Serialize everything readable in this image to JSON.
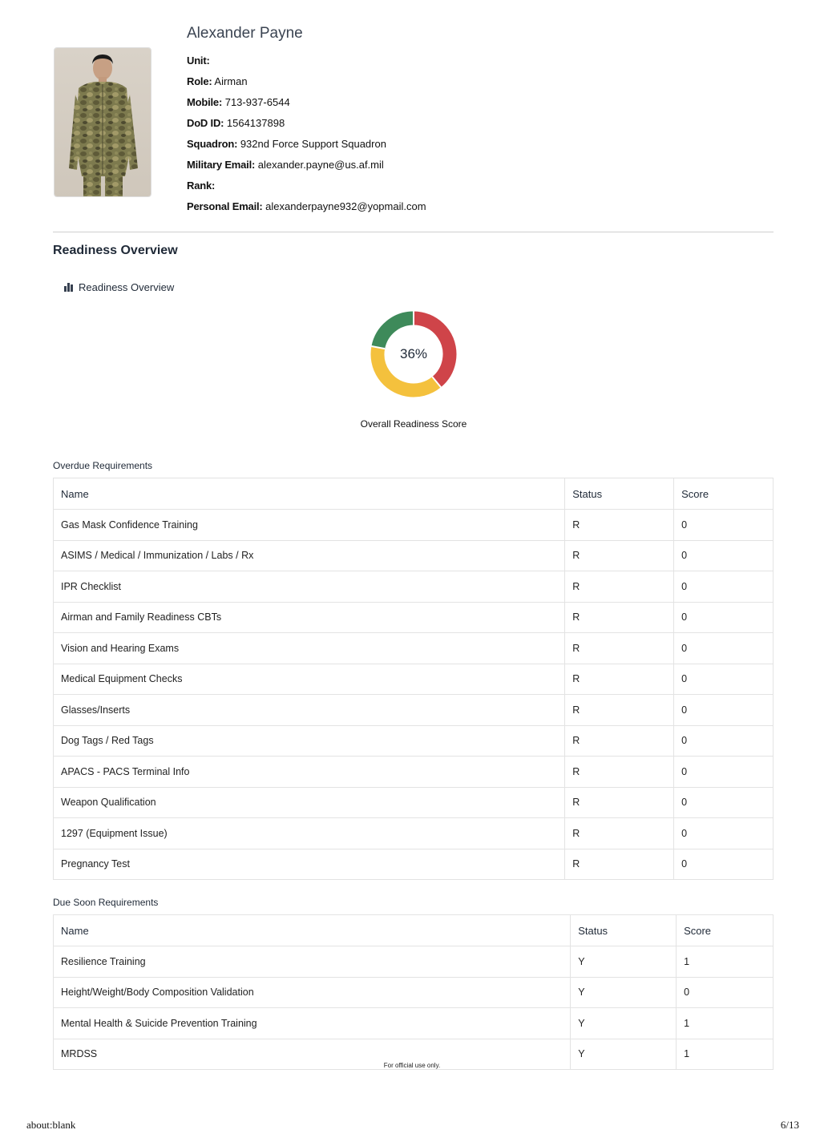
{
  "profile": {
    "name": "Alexander Payne",
    "fields": [
      {
        "label": "Unit:",
        "value": ""
      },
      {
        "label": "Role:",
        "value": "Airman"
      },
      {
        "label": "Mobile:",
        "value": "713-937-6544"
      },
      {
        "label": "DoD ID:",
        "value": "1564137898"
      },
      {
        "label": "Squadron:",
        "value": "932nd Force Support Squadron"
      },
      {
        "label": "Military Email:",
        "value": "alexander.payne@us.af.mil"
      },
      {
        "label": "Rank:",
        "value": ""
      },
      {
        "label": "Personal Email:",
        "value": "alexanderpayne932@yopmail.com"
      }
    ]
  },
  "readiness": {
    "section_title": "Readiness Overview",
    "subheading": "Readiness Overview",
    "score_label": "36%",
    "score_percent": 36,
    "caption": "Overall Readiness Score",
    "segments": [
      {
        "status": "G",
        "fraction": 0.22,
        "color": "#3e8a5a"
      },
      {
        "status": "R",
        "fraction": 0.39,
        "color": "#cf4449"
      },
      {
        "status": "Y",
        "fraction": 0.39,
        "color": "#f4c13d"
      }
    ]
  },
  "overdue": {
    "label": "Overdue Requirements",
    "headers": [
      "Name",
      "Status",
      "Score"
    ],
    "rows": [
      [
        "Gas Mask Confidence Training",
        "R",
        "0"
      ],
      [
        "ASIMS / Medical / Immunization / Labs / Rx",
        "R",
        "0"
      ],
      [
        "IPR Checklist",
        "R",
        "0"
      ],
      [
        "Airman and Family Readiness CBTs",
        "R",
        "0"
      ],
      [
        "Vision and Hearing Exams",
        "R",
        "0"
      ],
      [
        "Medical Equipment Checks",
        "R",
        "0"
      ],
      [
        "Glasses/Inserts",
        "R",
        "0"
      ],
      [
        "Dog Tags / Red Tags",
        "R",
        "0"
      ],
      [
        "APACS - PACS Terminal Info",
        "R",
        "0"
      ],
      [
        "Weapon Qualification",
        "R",
        "0"
      ],
      [
        "1297 (Equipment Issue)",
        "R",
        "0"
      ],
      [
        "Pregnancy Test",
        "R",
        "0"
      ]
    ]
  },
  "due_soon": {
    "label": "Due Soon Requirements",
    "headers": [
      "Name",
      "Status",
      "Score"
    ],
    "rows": [
      [
        "Resilience Training",
        "Y",
        "1"
      ],
      [
        "Height/Weight/Body Composition Validation",
        "Y",
        "0"
      ],
      [
        "Mental Health & Suicide Prevention Training",
        "Y",
        "1"
      ],
      [
        "MRDSS",
        "Y",
        "1"
      ]
    ]
  },
  "footnote": "For official use only.",
  "footer": {
    "url": "about:blank",
    "page": "6/13"
  }
}
